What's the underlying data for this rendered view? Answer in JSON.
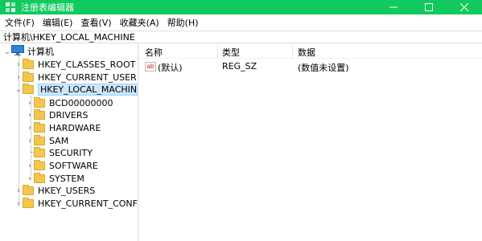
{
  "window": {
    "title": "注册表编辑器"
  },
  "menu": [
    {
      "label": "文件(F)"
    },
    {
      "label": "编辑(E)"
    },
    {
      "label": "查看(V)"
    },
    {
      "label": "收藏夹(A)"
    },
    {
      "label": "帮助(H)"
    }
  ],
  "address": {
    "path": "计算机\\HKEY_LOCAL_MACHINE"
  },
  "tree": {
    "root": "计算机",
    "hives": [
      {
        "label": "HKEY_CLASSES_ROOT"
      },
      {
        "label": "HKEY_CURRENT_USER"
      },
      {
        "label": "HKEY_LOCAL_MACHINE"
      },
      {
        "label": "HKEY_USERS"
      },
      {
        "label": "HKEY_CURRENT_CONFIG"
      }
    ],
    "local_machine_children": [
      {
        "label": "BCD00000000"
      },
      {
        "label": "DRIVERS"
      },
      {
        "label": "HARDWARE"
      },
      {
        "label": "SAM"
      },
      {
        "label": "SECURITY"
      },
      {
        "label": "SOFTWARE"
      },
      {
        "label": "SYSTEM"
      }
    ]
  },
  "list": {
    "headers": {
      "name": "名称",
      "type": "类型",
      "data": "数据"
    },
    "rows": [
      {
        "name": "(默认)",
        "type": "REG_SZ",
        "data": "(数值未设置)",
        "icon": "ab-icon"
      }
    ]
  },
  "colors": {
    "titlebar": "#12c95f",
    "selection": "#cce8ff",
    "folder": "#f4c64c"
  },
  "icons": {
    "app": "registry-icon",
    "minimize": "minimize-icon",
    "maximize": "maximize-icon",
    "close": "close-icon",
    "computer": "computer-icon",
    "folder": "folder-icon",
    "expand": "chevron-right-icon",
    "collapse": "chevron-down-icon"
  }
}
